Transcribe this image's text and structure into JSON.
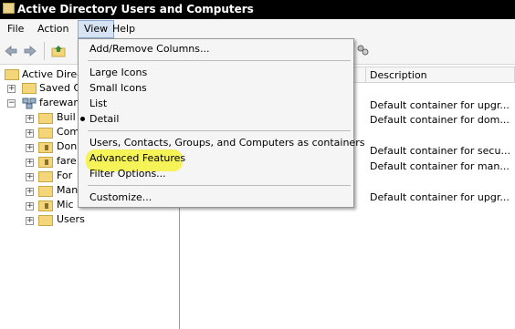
{
  "window": {
    "title": "Active Directory Users and Computers"
  },
  "menubar": {
    "items": [
      "File",
      "Action",
      "View",
      "Help"
    ],
    "active": "View"
  },
  "view_menu": {
    "items": [
      "Add/Remove Columns...",
      "Large Icons",
      "Small Icons",
      "List",
      "Detail",
      "Users, Contacts, Groups, and Computers as containers",
      "Advanced Features",
      "Filter Options...",
      "Customize..."
    ],
    "checked": "Detail",
    "highlighted": "Advanced Features",
    "highlight_color": "#f5f23c"
  },
  "tree": {
    "root": "Active Directo",
    "saved": "Saved Q",
    "domain": "farewan",
    "children": [
      "Buil",
      "Com",
      "Don",
      "fare",
      "For",
      "Man",
      "Mic",
      "Users"
    ]
  },
  "list": {
    "column_header": "Description",
    "rows": [
      "Default container for upgr...",
      "Default container for dom...",
      "Default container for secu...",
      "Default container for man...",
      "Default container for upgr..."
    ]
  }
}
